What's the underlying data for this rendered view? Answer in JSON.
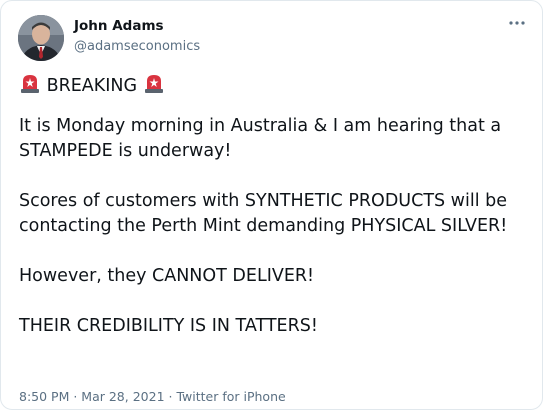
{
  "author": {
    "display_name": "John Adams",
    "handle": "@adamseconomics"
  },
  "icons": {
    "avatar": "profile-photo",
    "more": "more-horizontal-icon",
    "siren": "police-car-light-emoji"
  },
  "tweet": {
    "breaking": "BREAKING",
    "paragraphs": [
      "It is Monday morning in Australia & I am hearing that a STAMPEDE is underway!",
      "Scores of customers with SYNTHETIC PRODUCTS will be contacting the Perth Mint demanding PHYSICAL SILVER!",
      "However, they CANNOT DELIVER!",
      "THEIR CREDIBILITY IS IN TATTERS!"
    ]
  },
  "meta": {
    "time": "8:50 PM",
    "separator": " · ",
    "date": "Mar 28, 2021",
    "source": "Twitter for iPhone"
  },
  "colors": {
    "text": "#0f1419",
    "secondary": "#5b7083",
    "border": "#e1e8ed",
    "siren_red": "#d9333f"
  }
}
